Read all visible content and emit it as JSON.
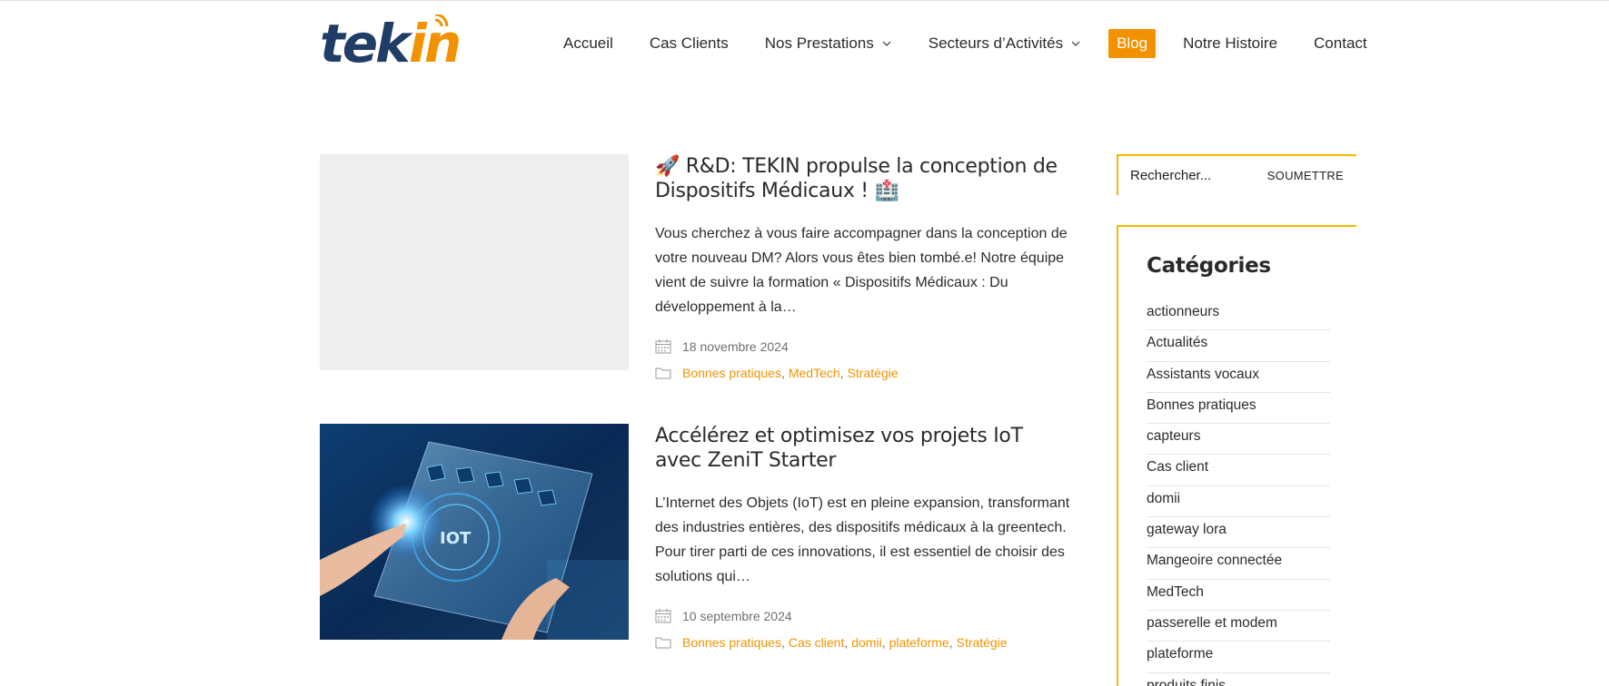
{
  "brand": {
    "logo_text_dark": "tek",
    "logo_text_accent": "in",
    "colors": {
      "dark": "#1f3d66",
      "accent": "#f39200",
      "sidebar_border": "#f3b900"
    }
  },
  "nav": {
    "items": [
      {
        "label": "Accueil"
      },
      {
        "label": "Cas Clients"
      },
      {
        "label": "Nos Prestations"
      },
      {
        "label": "Secteurs d’Activités"
      },
      {
        "label": "Blog"
      },
      {
        "label": "Notre Histoire"
      },
      {
        "label": "Contact"
      }
    ],
    "active": "Blog"
  },
  "posts": [
    {
      "title": "🚀 R&D: TEKIN propulse la conception de Dispositifs Médicaux ! 🏥",
      "excerpt": "Vous cherchez à vous faire accompagner dans la conception de votre nouveau DM? Alors vous êtes bien tombé.e! Notre équipe vient de suivre la formation « Dispositifs Médicaux : Du développement à la…",
      "date": "18 novembre 2024",
      "categories": [
        "Bonnes pratiques",
        "MedTech",
        "Stratégie"
      ],
      "icons": {
        "date": "calendar-icon",
        "categories": "folder-icon"
      }
    },
    {
      "title": "Accélérez et optimisez vos projets IoT avec ZeniT Starter",
      "excerpt": "L’Internet des Objets (IoT) est en pleine expansion, transformant des industries entières, des dispositifs médicaux à la greentech. Pour tirer parti de ces innovations, il est essentiel de choisir des solutions qui…",
      "date": "10 septembre 2024",
      "categories": [
        "Bonnes pratiques",
        "Cas client",
        "domii",
        "plateforme",
        "Stratégie"
      ],
      "image_text": "IOT",
      "icons": {
        "date": "calendar-icon",
        "categories": "folder-icon"
      }
    }
  ],
  "sidebar": {
    "search": {
      "placeholder": "Rechercher...",
      "button": "SOUMETTRE"
    },
    "categories": {
      "title": "Catégories",
      "items": [
        "actionneurs",
        "Actualités",
        "Assistants vocaux",
        "Bonnes pratiques",
        "capteurs",
        "Cas client",
        "domii",
        "gateway lora",
        "Mangeoire connectée",
        "MedTech",
        "passerelle et modem",
        "plateforme",
        "produits finis"
      ]
    }
  }
}
